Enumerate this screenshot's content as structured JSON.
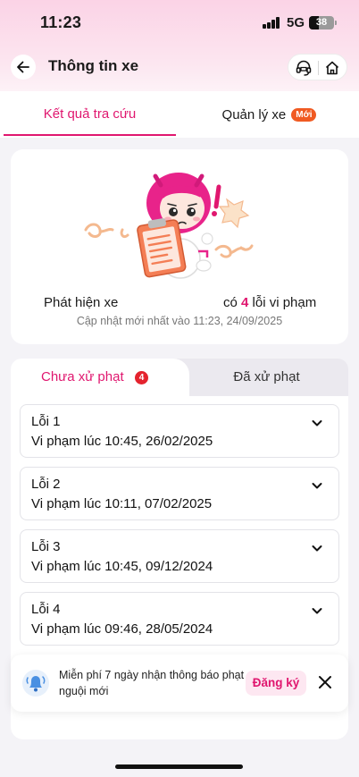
{
  "status_bar": {
    "time": "11:23",
    "network": "5G",
    "battery": "38",
    "battery_level": 0.38
  },
  "header": {
    "title": "Thông tin xe",
    "back_icon": "arrow-left-icon",
    "support_icon": "headset-icon",
    "home_icon": "home-icon"
  },
  "tabs": [
    {
      "label": "Kết quả tra cứu",
      "active": true
    },
    {
      "label": "Quản lý xe",
      "badge": "Mới",
      "active": false
    }
  ],
  "result": {
    "detect_prefix": "Phát hiện xe",
    "count_prefix": "có",
    "count": "4",
    "count_suffix": "lỗi vi phạm",
    "updated": "Cập nhật mới nhất vào 11:23, 24/09/2025"
  },
  "violation_tabs": [
    {
      "label": "Chưa xử phạt",
      "count": "4",
      "active": true
    },
    {
      "label": "Đã xử phạt",
      "active": false
    }
  ],
  "violations": [
    {
      "name": "Lỗi 1",
      "time": "Vi phạm lúc 10:45, 26/02/2025"
    },
    {
      "name": "Lỗi 2",
      "time": "Vi phạm lúc 10:11, 07/02/2025"
    },
    {
      "name": "Lỗi 3",
      "time": "Vi phạm lúc 10:45, 09/12/2024"
    },
    {
      "name": "Lỗi 4",
      "time": "Vi phạm lúc 09:46, 28/05/2024"
    }
  ],
  "promo": {
    "text": "Miễn phí 7 ngày nhận thông báo phạt nguội mới",
    "button": "Đăng ký",
    "icon": "bell-icon",
    "close_icon": "close-icon"
  },
  "colors": {
    "accent": "#e0176f",
    "badge_new": "#f05a22",
    "count_badge": "#e4232e"
  }
}
